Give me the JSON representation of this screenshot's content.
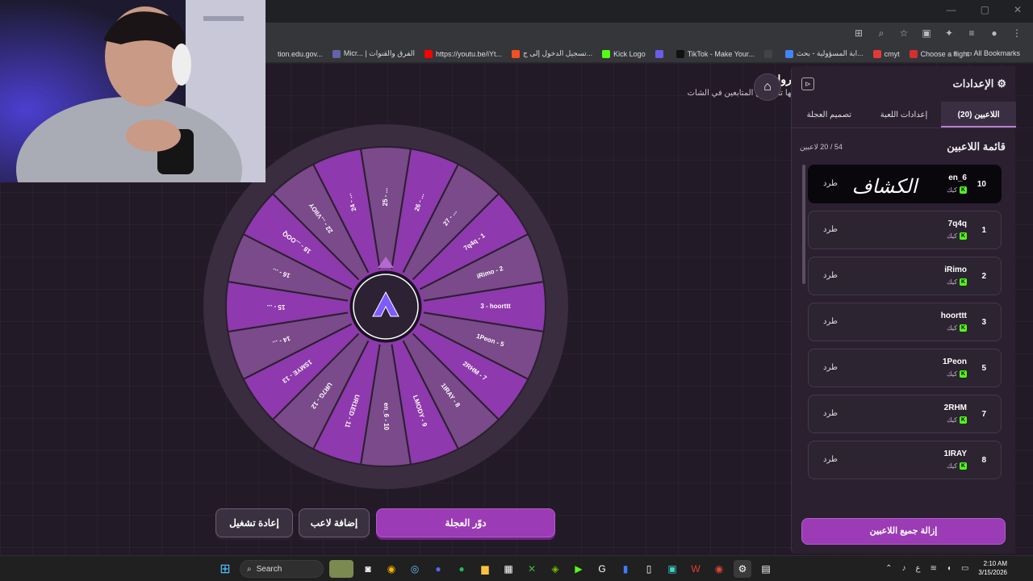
{
  "browser": {
    "window_controls": [
      "—",
      "▢",
      "✕"
    ],
    "bookmarks": [
      {
        "label": "tion.edu.gov...",
        "color": "#35363a"
      },
      {
        "label": "Micr...  | الفرق والقنوات",
        "color": "#6264a7"
      },
      {
        "label": "https://youtu.be/iYt...",
        "color": "#ff0000"
      },
      {
        "label": "تسجيل الدخول إلى ج...",
        "color": "#f25022"
      },
      {
        "label": "Kick Logo",
        "color": "#53fc18"
      },
      {
        "label": "",
        "color": "#6c5ce7"
      },
      {
        "label": "TikTok - Make Your...",
        "color": "#111111"
      },
      {
        "label": "",
        "color": "#444444"
      },
      {
        "label": "ابة المسؤولية - بحث...",
        "color": "#4285f4"
      },
      {
        "label": "cmyt",
        "color": "#e53935"
      },
      {
        "label": "Choose a flight",
        "color": "#d32f2f"
      }
    ],
    "more_bookmarks": "»",
    "all_bookmarks": "All Bookmarks"
  },
  "page": {
    "title": "الروليت",
    "subtitle": "خلها تقب بين المتابعين في الشات"
  },
  "wheel": {
    "colors": [
      "#8e39ad",
      "#7a4a8a"
    ],
    "segments": [
      "3 - hoorttt",
      "1Peon - 5",
      "2RHM - 7",
      "1IRAY - 8",
      "LMODY - 9",
      "en_6 - 10",
      "UR1ED - 11",
      "UR7G - 12",
      "1SMYE - 13",
      "14 - ...",
      "15 - ...",
      "16 - ...",
      "18 - ...OOQ",
      "22 - ...VIIOY",
      "24 - ...",
      "25 - ...",
      "26 - ...",
      "27 - ...",
      "7q4q - 1",
      "iRimo - 2"
    ]
  },
  "buttons": {
    "spin": "دوّر العجلة",
    "add_player": "إضافة لاعب",
    "restart": "إعادة تشغيل"
  },
  "panel": {
    "title": "الإعدادات",
    "tabs": [
      "اللاعبين (20)",
      "إعدادات اللعبة",
      "تصميم العجلة"
    ],
    "list_title": "قائمة اللاعبين",
    "count": "54 / 20 لاعبين",
    "kick_label": "طرد",
    "platform": "كيك",
    "players": [
      {
        "rank": "10",
        "name": "en_6"
      },
      {
        "rank": "1",
        "name": "7q4q"
      },
      {
        "rank": "2",
        "name": "iRimo"
      },
      {
        "rank": "3",
        "name": "hoorttt"
      },
      {
        "rank": "5",
        "name": "1Peon"
      },
      {
        "rank": "7",
        "name": "2RHM"
      },
      {
        "rank": "8",
        "name": "1IRAY"
      }
    ],
    "remove_all": "إزالة جميع اللاعبين",
    "signature": "الكشاف"
  },
  "taskbar": {
    "search": "Search",
    "lang": "ع",
    "time": "2:10 AM",
    "date": "3/15/2026"
  }
}
